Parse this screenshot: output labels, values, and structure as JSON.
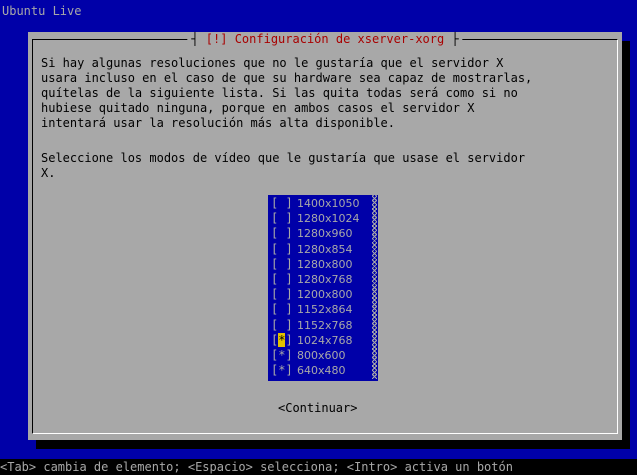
{
  "window_title": "Ubuntu Live",
  "dialog": {
    "title_bracket": "[!]",
    "title": "Configuración de xserver-xorg",
    "body": "Si hay algunas resoluciones que no le gustaría que el servidor X\nusara incluso en el caso de que su hardware sea capaz de mostrarlas,\nquítelas de la siguiente lista. Si las quita todas será como si no\nhubiese quitado ninguna, porque en ambos casos el servidor X\nintentará usar la resolución más alta disponible.",
    "prompt": "Seleccione los modos de vídeo que le gustaría que usase el servidor\nX.",
    "continue_label": "<Continuar>"
  },
  "modes": [
    {
      "label": "1400x1050",
      "checked": false
    },
    {
      "label": "1280x1024",
      "checked": false
    },
    {
      "label": "1280x960",
      "checked": false
    },
    {
      "label": "1280x854",
      "checked": false
    },
    {
      "label": "1280x800",
      "checked": false
    },
    {
      "label": "1280x768",
      "checked": false
    },
    {
      "label": "1200x800",
      "checked": false
    },
    {
      "label": "1152x864",
      "checked": false
    },
    {
      "label": "1152x768",
      "checked": false
    },
    {
      "label": "1024x768",
      "checked": true,
      "focused": true
    },
    {
      "label": "800x600",
      "checked": true
    },
    {
      "label": "640x480",
      "checked": true
    }
  ],
  "footer": "<Tab> cambia de elemento; <Espacio> selecciona; <Intro> activa un botón",
  "colors": {
    "screen_bg": "#0000a8",
    "dialog_bg": "#a8a8a8",
    "title_text": "#a80000",
    "focus_highlight": "#e0c000"
  }
}
